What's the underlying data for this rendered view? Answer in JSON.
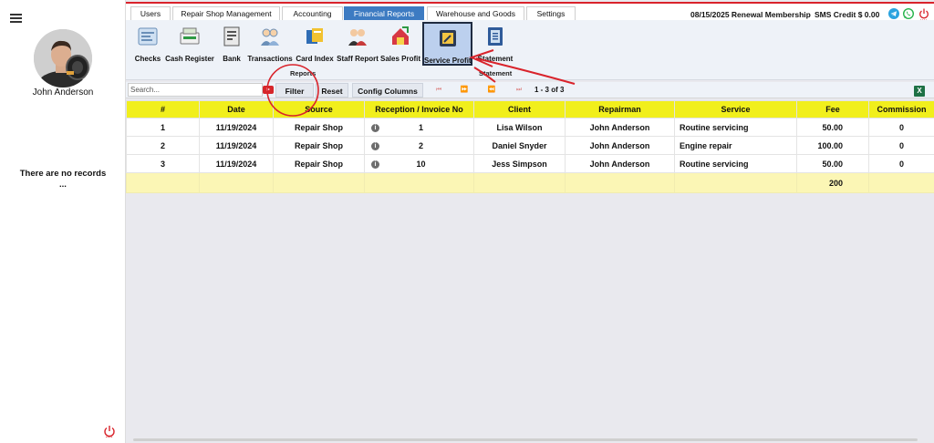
{
  "sidebar": {
    "user_name": "John Anderson",
    "empty_text_line1": "There are no records",
    "empty_text_line2": "..."
  },
  "tabs": [
    {
      "label": "Users"
    },
    {
      "label": "Repair Shop Management"
    },
    {
      "label": "Accounting"
    },
    {
      "label": "Financial Reports",
      "active": true
    },
    {
      "label": "Warehouse and Goods"
    },
    {
      "label": "Settings"
    }
  ],
  "header": {
    "membership": "08/15/2025 Renewal Membership",
    "sms_credit": "SMS Credit $ 0.00"
  },
  "toolbar": {
    "tools": [
      {
        "label": "Checks",
        "icon": "checks-icon"
      },
      {
        "label": "Cash Register",
        "icon": "cash-register-icon"
      },
      {
        "label": "Bank",
        "icon": "bank-icon"
      },
      {
        "label": "Transactions",
        "icon": "transactions-icon"
      },
      {
        "label": "Card Index",
        "icon": "card-index-icon"
      },
      {
        "label": "Staff Report",
        "icon": "staff-report-icon"
      },
      {
        "label": "Sales Profit",
        "icon": "sales-profit-icon"
      },
      {
        "label": "Service Profit",
        "icon": "service-profit-icon",
        "active": true
      },
      {
        "label": "Statement",
        "icon": "statement-icon"
      }
    ],
    "group_reports": "Reports",
    "group_statement": "Statement"
  },
  "filterbar": {
    "search_placeholder": "Search...",
    "filter_label": "Filter",
    "reset_label": "Reset",
    "config_columns_label": "Config Columns",
    "page_info": "1 - 3 of 3",
    "pager_first": "⏮",
    "pager_next": "⏩",
    "pager_prev": "⏪",
    "pager_last": "⏭"
  },
  "table": {
    "columns": [
      "#",
      "Date",
      "Source",
      "Reception / Invoice No",
      "Client",
      "Repairman",
      "Service",
      "Fee",
      "Commission"
    ],
    "rows": [
      {
        "num": "1",
        "date": "11/19/2024",
        "source": "Repair Shop",
        "invoice": "1",
        "client": "Lisa Wilson",
        "repairman": "John Anderson",
        "service": "Routine servicing",
        "fee": "50.00",
        "commission": "0"
      },
      {
        "num": "2",
        "date": "11/19/2024",
        "source": "Repair Shop",
        "invoice": "2",
        "client": "Daniel Snyder",
        "repairman": "John Anderson",
        "service": "Engine repair",
        "fee": "100.00",
        "commission": "0"
      },
      {
        "num": "3",
        "date": "11/19/2024",
        "source": "Repair Shop",
        "invoice": "10",
        "client": "Jess Simpson",
        "repairman": "John Anderson",
        "service": "Routine servicing",
        "fee": "50.00",
        "commission": "0"
      }
    ],
    "total_fee": "200"
  },
  "colors": {
    "accent_red": "#d9232b",
    "active_tab": "#3d7bc2",
    "header_yellow": "#f1ef1c",
    "total_row": "#fbf6b5",
    "annotation_red": "#d9232b"
  }
}
